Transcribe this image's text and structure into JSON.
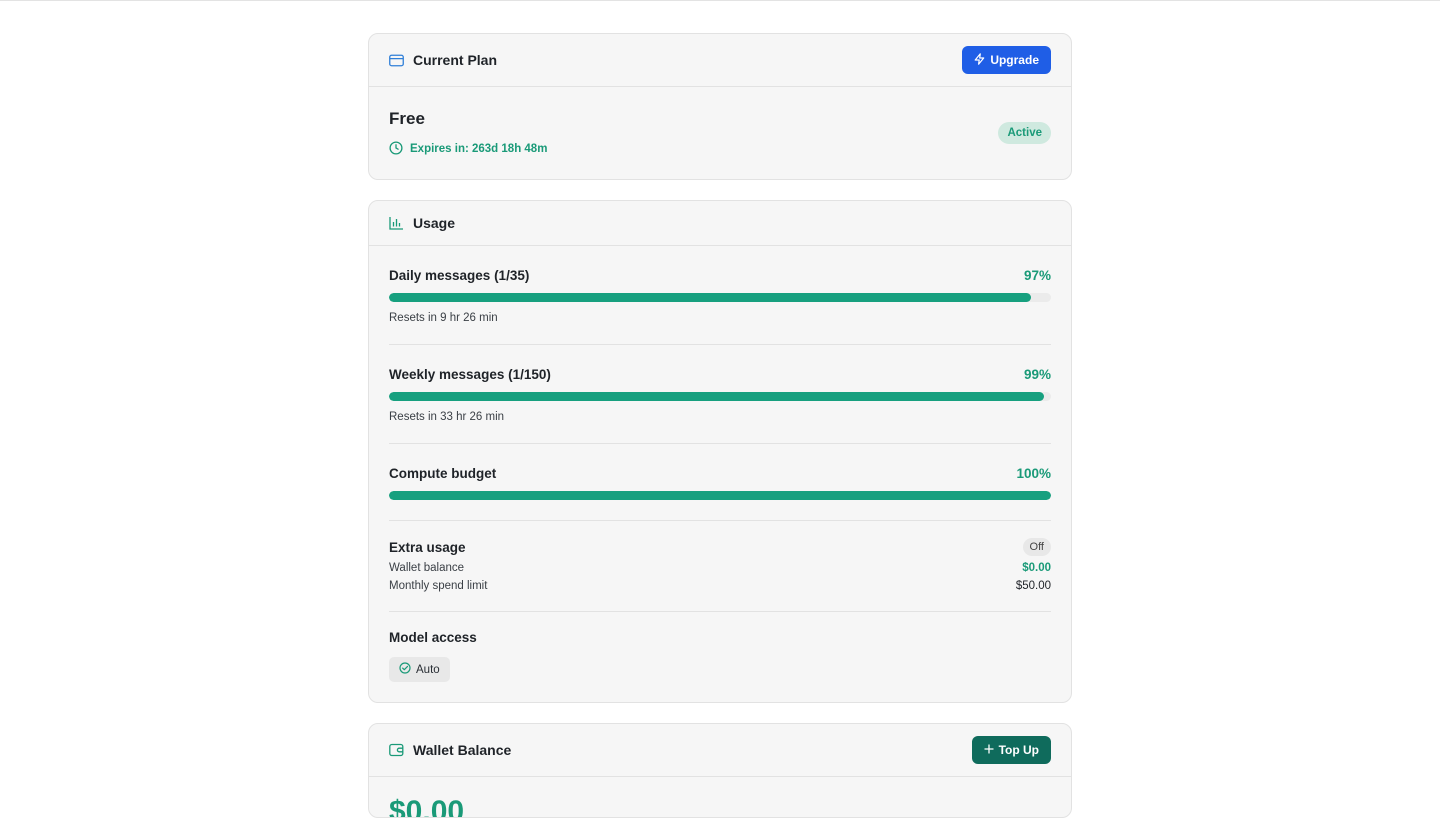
{
  "plan": {
    "title": "Current Plan",
    "upgrade_label": "Upgrade",
    "name": "Free",
    "expires": "Expires in: 263d 18h 48m",
    "status": "Active"
  },
  "usage": {
    "title": "Usage",
    "meters": [
      {
        "label": "Daily messages (1/35)",
        "pct_text": "97%",
        "fill": 0.97,
        "reset": "Resets in 9 hr 26 min"
      },
      {
        "label": "Weekly messages (1/150)",
        "pct_text": "99%",
        "fill": 0.99,
        "reset": "Resets in 33 hr 26 min"
      },
      {
        "label": "Compute budget",
        "pct_text": "100%",
        "fill": 1.0
      }
    ],
    "extra": {
      "title": "Extra usage",
      "state": "Off",
      "wallet_label": "Wallet balance",
      "wallet_value": "$0.00",
      "limit_label": "Monthly spend limit",
      "limit_value": "$50.00"
    },
    "model": {
      "title": "Model access",
      "chip": "Auto"
    }
  },
  "wallet": {
    "title": "Wallet Balance",
    "topup_label": "Top Up",
    "balance": "$0.00"
  },
  "colors": {
    "accent_green": "#1a9a78",
    "bar_green": "#17a07f",
    "upgrade_blue": "#1f5ee6",
    "topup_teal": "#0f6b5c"
  },
  "icons": {
    "plan": "credit-card-icon",
    "upgrade": "zap-icon",
    "expires": "clock-icon",
    "usage": "bar-chart-icon",
    "model_chip": "check-circle-icon",
    "wallet": "wallet-icon",
    "topup": "plus-icon"
  }
}
